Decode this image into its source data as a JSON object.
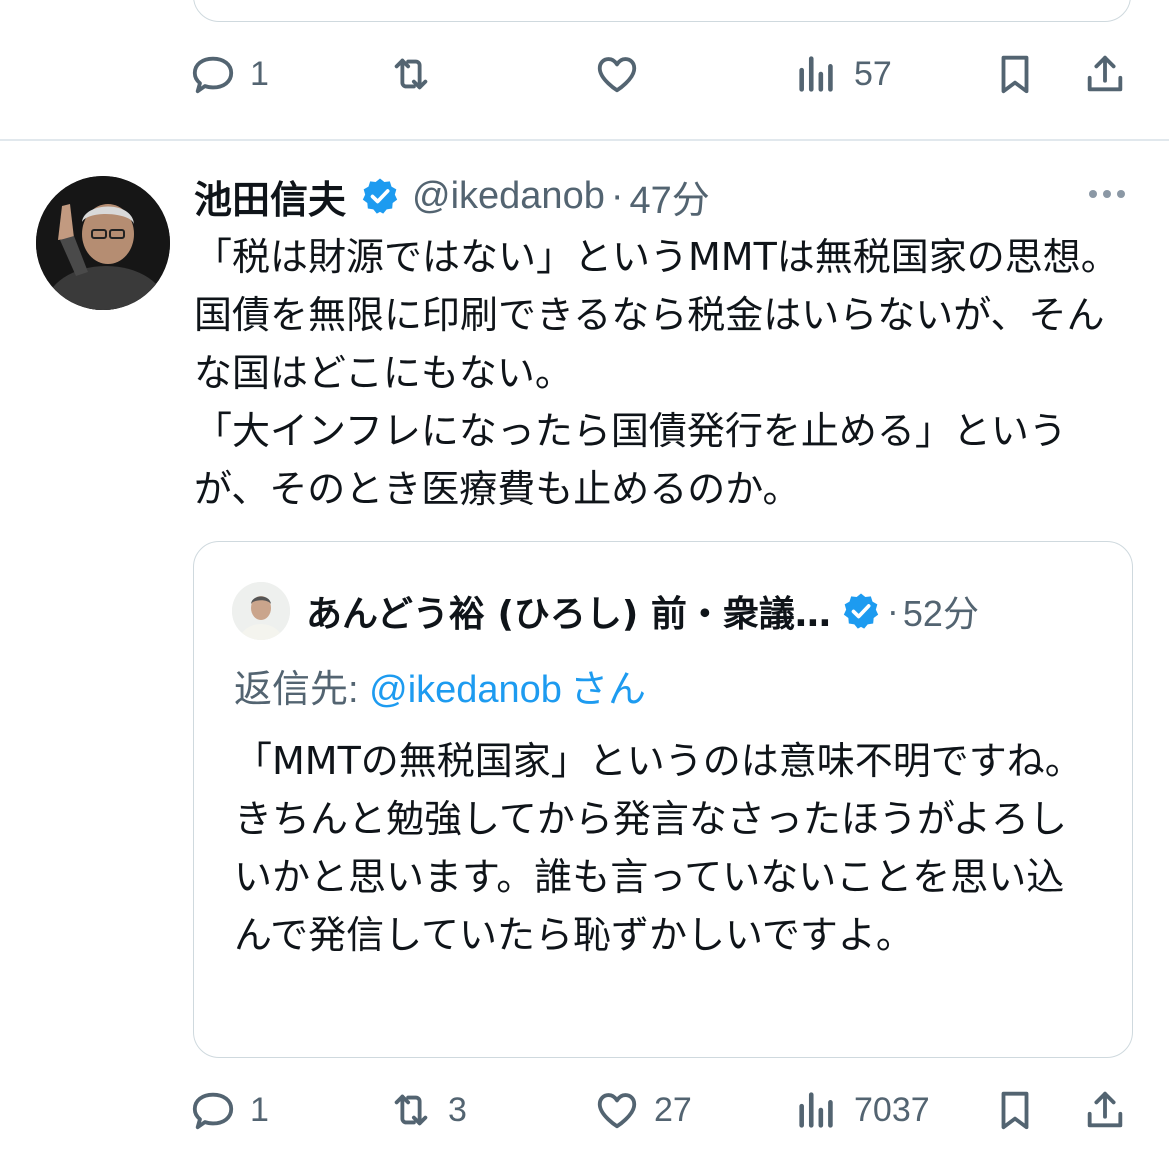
{
  "previous_tweet": {
    "actions": {
      "replies": "1",
      "retweets": "",
      "likes": "",
      "views": "57"
    }
  },
  "tweet": {
    "author_name": "池田信夫",
    "handle": "@ikedanob",
    "separator": "·",
    "time": "47分",
    "text": "「税は財源ではない」というMMTは無税国家の思想。国債を無限に印刷できるなら税金はいらないが、そんな国はどこにもない。\n「大インフレになったら国債発行を止める」というが、そのとき医療費も止めるのか。",
    "quote": {
      "author_name": "あんどう裕 (ひろし) 前・衆議…",
      "separator": "·",
      "time": "52分",
      "reply_prefix": "返信先: ",
      "reply_mention": "@ikedanob",
      "reply_suffix": "さん",
      "text": "「MMTの無税国家」というのは意味不明ですね。きちんと勉強してから発言なさったほうがよろしいかと思います。誰も言っていないことを思い込んで発信していたら恥ずかしいですよ。"
    },
    "actions": {
      "replies": "1",
      "retweets": "3",
      "likes": "27",
      "views": "7037"
    }
  },
  "colors": {
    "accent": "#1d9bf0",
    "secondary_text": "#536471",
    "border": "#cfd9de"
  },
  "icons": [
    "reply-icon",
    "retweet-icon",
    "like-icon",
    "views-icon",
    "bookmark-icon",
    "share-icon",
    "verified-badge-icon",
    "more-icon"
  ]
}
